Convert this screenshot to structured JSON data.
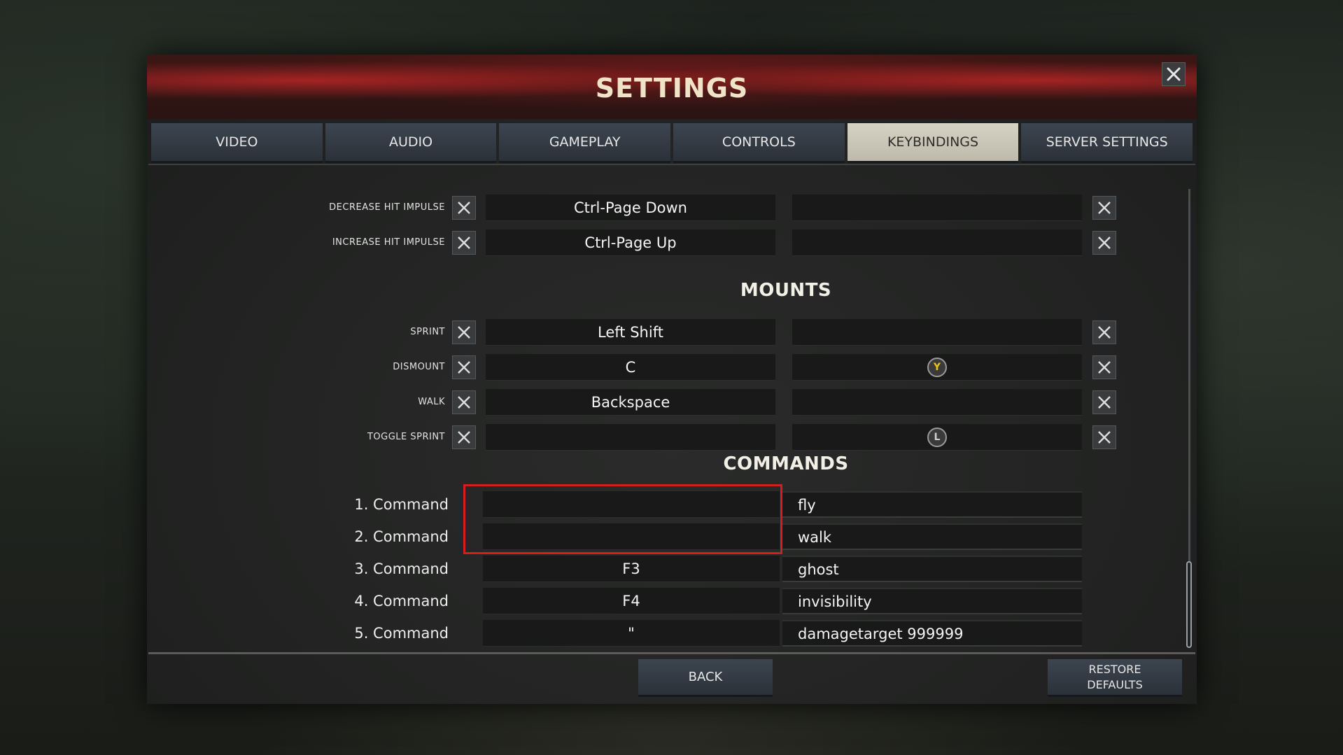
{
  "window": {
    "title": "SETTINGS"
  },
  "tabs": [
    {
      "label": "VIDEO"
    },
    {
      "label": "AUDIO"
    },
    {
      "label": "GAMEPLAY"
    },
    {
      "label": "CONTROLS"
    },
    {
      "label": "KEYBINDINGS",
      "active": true
    },
    {
      "label": "SERVER SETTINGS"
    }
  ],
  "keybindings": {
    "top_rows": [
      {
        "label": "DECREASE HIT IMPULSE",
        "primary": "Ctrl-Page Down",
        "secondary": ""
      },
      {
        "label": "INCREASE HIT IMPULSE",
        "primary": "Ctrl-Page Up",
        "secondary": ""
      }
    ],
    "mounts": {
      "title": "MOUNTS",
      "rows": [
        {
          "label": "SPRINT",
          "primary": "Left Shift",
          "secondary": ""
        },
        {
          "label": "DISMOUNT",
          "primary": "C",
          "secondary_icon": "gamepad-y-button-icon",
          "secondary_icon_text": "Y"
        },
        {
          "label": "WALK",
          "primary": "Backspace",
          "secondary": ""
        },
        {
          "label": "TOGGLE SPRINT",
          "primary": "",
          "secondary_icon": "gamepad-left-stick-icon",
          "secondary_icon_text": "L"
        }
      ]
    },
    "commands": {
      "title": "COMMANDS",
      "rows": [
        {
          "label": "1. Command",
          "key": "",
          "command": "fly"
        },
        {
          "label": "2. Command",
          "key": "",
          "command": "walk"
        },
        {
          "label": "3. Command",
          "key": "F3",
          "command": "ghost"
        },
        {
          "label": "4. Command",
          "key": "F4",
          "command": "invisibility"
        },
        {
          "label": "5. Command",
          "key": "\"",
          "command": "damagetarget 999999"
        }
      ]
    }
  },
  "footer": {
    "back_label": "BACK",
    "restore_label_line1": "RESTORE",
    "restore_label_line2": "DEFAULTS"
  },
  "colors": {
    "highlight": "#d11f1f",
    "active_tab": "#d6d2c4",
    "title": "#f0e4c8",
    "y_button": "#e8c419"
  }
}
